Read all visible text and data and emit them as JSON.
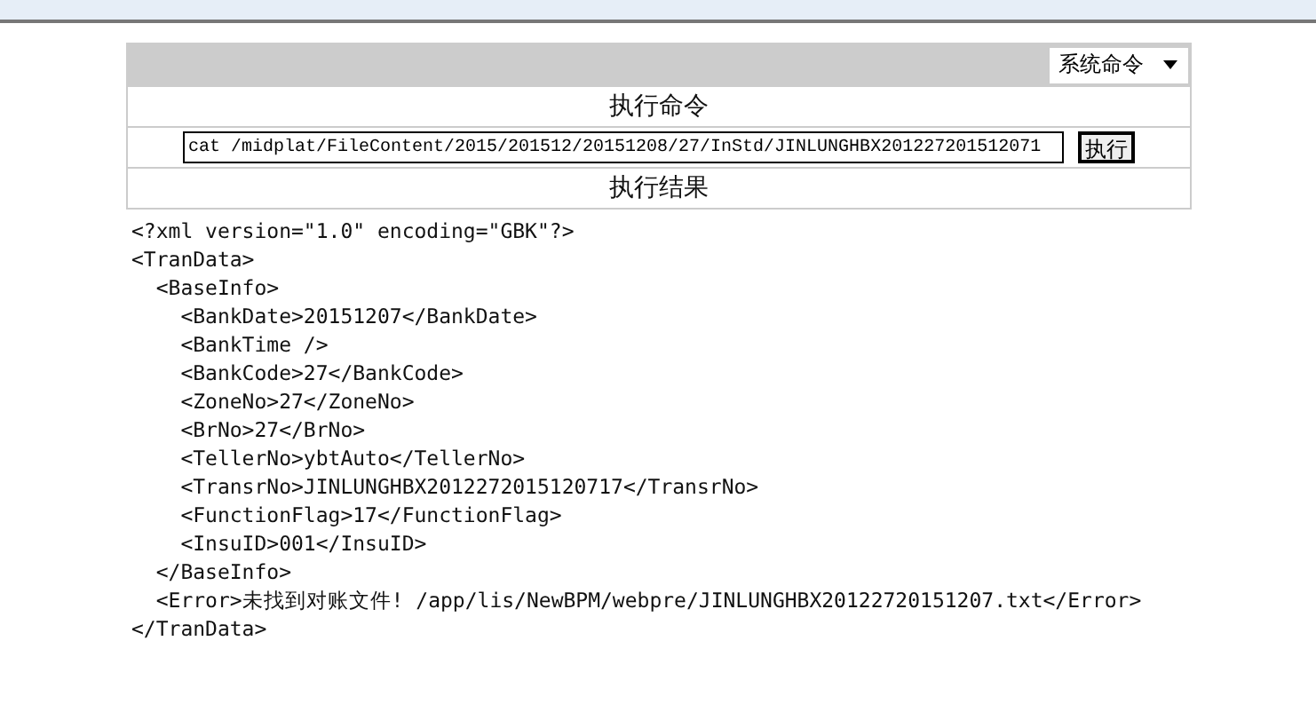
{
  "select": {
    "value": "系统命令"
  },
  "command_header": "执行命令",
  "command_field": {
    "value": "cat /midplat/FileContent/2015/201512/20151208/27/InStd/JINLUNGHBX201227201512071"
  },
  "execute_button": "执行",
  "result_header": "执行结果",
  "output_lines": [
    "<?xml version=\"1.0\" encoding=\"GBK\"?>",
    "<TranData>",
    "  <BaseInfo>",
    "    <BankDate>20151207</BankDate>",
    "    <BankTime />",
    "    <BankCode>27</BankCode>",
    "    <ZoneNo>27</ZoneNo>",
    "    <BrNo>27</BrNo>",
    "    <TellerNo>ybtAuto</TellerNo>",
    "    <TransrNo>JINLUNGHBX2012272015120717</TransrNo>",
    "    <FunctionFlag>17</FunctionFlag>",
    "    <InsuID>001</InsuID>",
    "  </BaseInfo>",
    "  <Error>未找到对账文件! /app/lis/NewBPM/webpre/JINLUNGHBX20122720151207.txt</Error>",
    "</TranData>"
  ]
}
